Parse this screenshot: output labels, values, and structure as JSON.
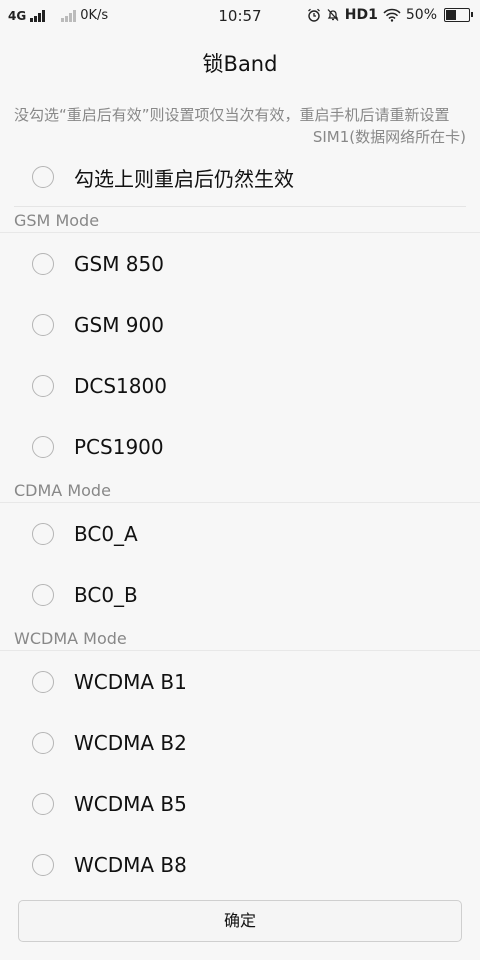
{
  "status_bar": {
    "network_type": "4G",
    "speed": "0K/s",
    "time": "10:57",
    "hd_label": "HD1",
    "battery_text": "50%",
    "battery_level": 0.5
  },
  "header": {
    "title": "锁Band"
  },
  "notice": "没勾选“重启后有效”则设置项仅当次有效，重启手机后请重新设置",
  "sim_label": "SIM1(数据网络所在卡)",
  "persist_option": {
    "label": "勾选上则重启后仍然生效",
    "checked": false
  },
  "sections": [
    {
      "title": "GSM Mode",
      "options": [
        {
          "label": "GSM 850",
          "checked": false
        },
        {
          "label": "GSM 900",
          "checked": false
        },
        {
          "label": "DCS1800",
          "checked": false
        },
        {
          "label": "PCS1900",
          "checked": false
        }
      ]
    },
    {
      "title": "CDMA Mode",
      "options": [
        {
          "label": "BC0_A",
          "checked": false
        },
        {
          "label": "BC0_B",
          "checked": false
        }
      ]
    },
    {
      "title": "WCDMA Mode",
      "options": [
        {
          "label": "WCDMA B1",
          "checked": false
        },
        {
          "label": "WCDMA B2",
          "checked": false
        },
        {
          "label": "WCDMA B5",
          "checked": false
        },
        {
          "label": "WCDMA B8",
          "checked": false
        }
      ]
    }
  ],
  "footer": {
    "confirm_label": "确定"
  }
}
